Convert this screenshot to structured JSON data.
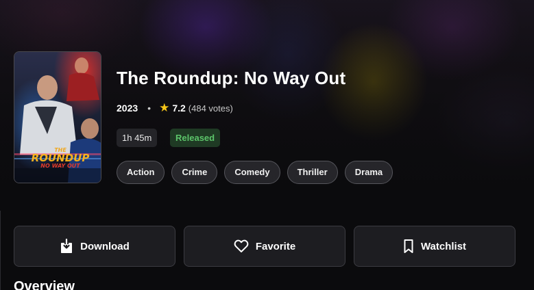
{
  "movie": {
    "title": "The Roundup: No Way Out",
    "year": "2023",
    "separator": "•",
    "rating": "7.2",
    "votes": "(484 votes)",
    "runtime": "1h 45m",
    "status": "Released",
    "genres": [
      "Action",
      "Crime",
      "Comedy",
      "Thriller",
      "Drama"
    ],
    "poster": {
      "title_line1": "THE",
      "title_line2": "ROUNDUP",
      "title_line3": "NO WAY OUT"
    }
  },
  "actions": {
    "download_label": "Download",
    "favorite_label": "Favorite",
    "watchlist_label": "Watchlist"
  },
  "sections": {
    "overview_heading": "Overview"
  },
  "colors": {
    "star": "#f5c518",
    "status_text": "#5cc46a",
    "status_bg": "#1f3a24"
  },
  "icons": {
    "rating": "star-icon",
    "download": "download-icon",
    "favorite": "heart-icon",
    "watchlist": "bookmark-icon"
  }
}
